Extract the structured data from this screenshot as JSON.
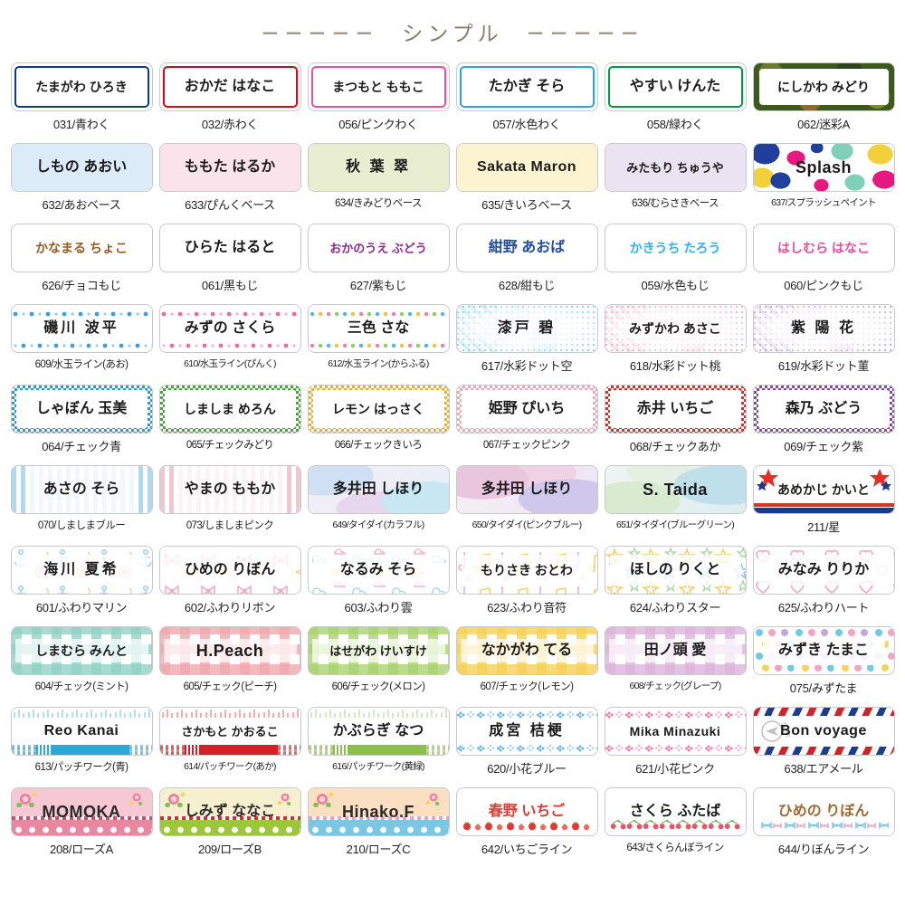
{
  "header": {
    "left_dashes": "－－－－－",
    "title": "シンプル",
    "right_dashes": "－－－－－"
  },
  "stickers": [
    {
      "name": "たまがわ ひろき",
      "caption": "031/青わく",
      "style": "frame",
      "accent": "#0b3b8f"
    },
    {
      "name": "おかだ はなこ",
      "caption": "032/赤わく",
      "style": "frame",
      "accent": "#e60012"
    },
    {
      "name": "まつもと ももこ",
      "caption": "056/ピンクわく",
      "style": "frame",
      "accent": "#ee4d9b"
    },
    {
      "name": "たかぎ そら",
      "caption": "057/水色わく",
      "style": "frame",
      "accent": "#27a6e5"
    },
    {
      "name": "やすい けんた",
      "caption": "058/緑わく",
      "style": "frame",
      "accent": "#009944"
    },
    {
      "name": "にしかわ みどり",
      "caption": "062/迷彩A",
      "style": "camo",
      "accent": "#3d5a1e"
    },
    {
      "name": "しもの あおい",
      "caption": "632/あおベース",
      "style": "base",
      "accent": "#dcebf8"
    },
    {
      "name": "ももた はるか",
      "caption": "633/ぴんくベース",
      "style": "base",
      "accent": "#fae3ea"
    },
    {
      "name": "秋 葉 翠",
      "caption": "634/きみどりベース",
      "style": "base",
      "accent": "#e9eed0"
    },
    {
      "name": "Sakata Maron",
      "caption": "635/きいろベース",
      "style": "base",
      "accent": "#fcf3d0"
    },
    {
      "name": "みたもり ちゅうや",
      "caption": "636/むらさきベース",
      "style": "base",
      "accent": "#ece3f2"
    },
    {
      "name": "Splash",
      "caption": "637/スプラッシュペイント",
      "style": "splash",
      "accent": "#ffffff"
    },
    {
      "name": "かなまる ちょこ",
      "caption": "626/チョコもじ",
      "style": "moji",
      "accent": "#9b5a1e"
    },
    {
      "name": "ひらた はると",
      "caption": "061/黒もじ",
      "style": "moji",
      "accent": "#1b1b1b"
    },
    {
      "name": "おかのうえ ぶどう",
      "caption": "627/紫もじ",
      "style": "moji",
      "accent": "#8a2a8f"
    },
    {
      "name": "紺野 あおば",
      "caption": "628/紺もじ",
      "style": "moji",
      "accent": "#1f4e9c"
    },
    {
      "name": "かきうち たろう",
      "caption": "059/水色もじ",
      "style": "moji",
      "accent": "#2fb3ef"
    },
    {
      "name": "はしむら はなこ",
      "caption": "060/ピンクもじ",
      "style": "moji",
      "accent": "#ec4d96"
    },
    {
      "name": "磯川 波平",
      "caption": "609/水玉ライン(あお)",
      "style": "dotline",
      "accent": "#3aa0e0"
    },
    {
      "name": "みずの さくら",
      "caption": "610/水玉ライン(ぴんく)",
      "style": "dotline",
      "accent": "#ef6d9e"
    },
    {
      "name": "三色 さな",
      "caption": "612/水玉ライン(からふる)",
      "style": "dotlinec",
      "accent": "#49b9e8"
    },
    {
      "name": "漆戸 碧",
      "caption": "617/水彩ドット空",
      "style": "wdot",
      "accent": "#7fd3e3"
    },
    {
      "name": "みずかわ あさこ",
      "caption": "618/水彩ドット桃",
      "style": "wdot",
      "accent": "#f4a8c0"
    },
    {
      "name": "紫 陽 花",
      "caption": "619/水彩ドット菫",
      "style": "wdot",
      "accent": "#b9a9dd"
    },
    {
      "name": "しゃぼん 玉美",
      "caption": "064/チェック青",
      "style": "minicheck",
      "accent": "#1e9ce0"
    },
    {
      "name": "しましま めろん",
      "caption": "065/チェックみどり",
      "style": "minicheck",
      "accent": "#3faa31"
    },
    {
      "name": "レモン はっさく",
      "caption": "066/チェックきいろ",
      "style": "minicheck",
      "accent": "#f0ad1e"
    },
    {
      "name": "姫野 ぴいち",
      "caption": "067/チェックピンク",
      "style": "minicheck",
      "accent": "#f3a3b6"
    },
    {
      "name": "赤井 いちご",
      "caption": "068/チェックあか",
      "style": "minicheck",
      "accent": "#e22a22"
    },
    {
      "name": "森乃 ぶどう",
      "caption": "069/チェック紫",
      "style": "minicheck",
      "accent": "#8b44a8"
    },
    {
      "name": "あさの そら",
      "caption": "070/しましまブルー",
      "style": "stripe",
      "accent": "#a9dcf2"
    },
    {
      "name": "やまの ももか",
      "caption": "073/しましまピンク",
      "style": "stripe",
      "accent": "#f6c3d2"
    },
    {
      "name": "多井田 しほり",
      "caption": "649/タイダイ(カラフル)",
      "style": "tiedyeA",
      "accent": "#cfd9ee"
    },
    {
      "name": "多井田 しほり",
      "caption": "650/タイダイ(ピンクブルー)",
      "style": "tiedyeB",
      "accent": "#e3c4dd"
    },
    {
      "name": "S. Taida",
      "caption": "651/タイダイ(ブルーグリーン)",
      "style": "tiedyeC",
      "accent": "#cfe7e0"
    },
    {
      "name": "あめかじ かいと",
      "caption": "211/星",
      "style": "star",
      "accent": "#1a3a8f"
    },
    {
      "name": "海川 夏希",
      "caption": "601/ふわりマリン",
      "style": "fuwari-marine",
      "accent": "#9fd2ef"
    },
    {
      "name": "ひめの りぼん",
      "caption": "602/ふわりリボン",
      "style": "fuwari-ribbon",
      "accent": "#f7bdd0"
    },
    {
      "name": "なるみ そら",
      "caption": "603/ふわり雲",
      "style": "fuwari-cloud",
      "accent": "#b9e0f2"
    },
    {
      "name": "もりさき おとわ",
      "caption": "623/ふわり音符",
      "style": "fuwari-note",
      "accent": "#f3c9de"
    },
    {
      "name": "ほしの りくと",
      "caption": "624/ふわりスター",
      "style": "fuwari-star",
      "accent": "#f5d97a"
    },
    {
      "name": "みなみ りりか",
      "caption": "625/ふわりハート",
      "style": "fuwari-heart",
      "accent": "#f6b9c6"
    },
    {
      "name": "しまむら みんと",
      "caption": "604/チェック(ミント)",
      "style": "gingham",
      "accent": "#8fd2c7"
    },
    {
      "name": "H.Peach",
      "caption": "605/チェック(ピーチ)",
      "style": "gingham",
      "accent": "#f0a9ad"
    },
    {
      "name": "はせがわ けいすけ",
      "caption": "606/チェック(メロン)",
      "style": "gingham",
      "accent": "#a9d470"
    },
    {
      "name": "なかがわ てる",
      "caption": "607/チェック(レモン)",
      "style": "gingham",
      "accent": "#f7d057"
    },
    {
      "name": "田ノ頭 愛",
      "caption": "608/チェック(グレープ)",
      "style": "gingham",
      "accent": "#dcb3dd"
    },
    {
      "name": "みずき たまこ",
      "caption": "075/みずたま",
      "style": "polka",
      "accent": "#6fc9e8"
    },
    {
      "name": "Reo Kanai",
      "caption": "613/パッチワーク(青)",
      "style": "patch",
      "accent": "#2aa8d8"
    },
    {
      "name": "さかもと かおるこ",
      "caption": "614/パッチワーク(あか)",
      "style": "patch",
      "accent": "#d62027"
    },
    {
      "name": "かぶらぎ なつ",
      "caption": "616/パッチワーク(黄緑)",
      "style": "patch",
      "accent": "#8cbf4a"
    },
    {
      "name": "成宮 桔梗",
      "caption": "620/小花ブルー",
      "style": "kobana",
      "accent": "#6bb7e8"
    },
    {
      "name": "Mika Minazuki",
      "caption": "621/小花ピンク",
      "style": "kobana",
      "accent": "#ee7fa8"
    },
    {
      "name": "Bon voyage",
      "caption": "638/エアメール",
      "style": "airmail",
      "accent": "#1d3c8f"
    },
    {
      "name": "MOMOKA",
      "caption": "208/ローズA",
      "style": "roseA",
      "accent": "#f6c8d4"
    },
    {
      "name": "しみず ななこ",
      "caption": "209/ローズB",
      "style": "roseB",
      "accent": "#f7f0cf"
    },
    {
      "name": "Hinako.F",
      "caption": "210/ローズC",
      "style": "roseC",
      "accent": "#fadfc0"
    },
    {
      "name": "春野 いちご",
      "caption": "642/いちごライン",
      "style": "line-ichigo",
      "accent": "#e03a33"
    },
    {
      "name": "さくら ふたば",
      "caption": "643/さくらんぼライン",
      "style": "line-cherry",
      "accent": "#e8556a"
    },
    {
      "name": "ひめの りぼん",
      "caption": "644/りぼんライン",
      "style": "line-ribbon",
      "accent": "#8fd2e8"
    }
  ]
}
